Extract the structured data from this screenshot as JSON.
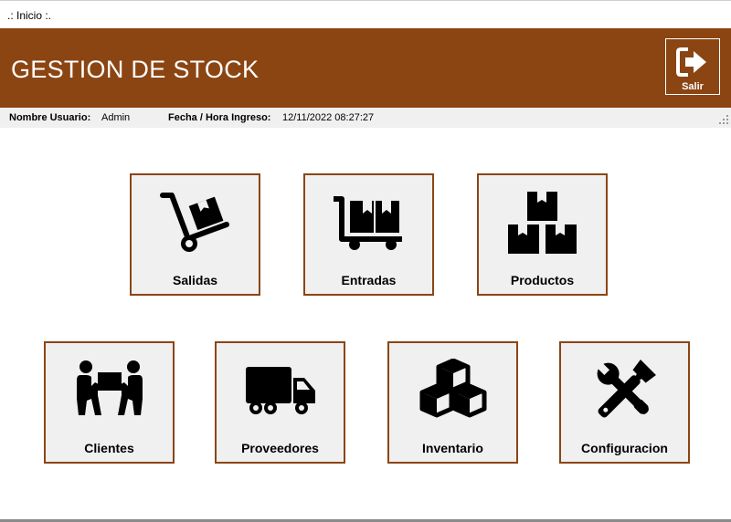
{
  "window": {
    "title": ".: Inicio :."
  },
  "header": {
    "title": "GESTION DE STOCK",
    "exit_label": "Salir",
    "bg_color": "#8b4513"
  },
  "info": {
    "user_label": "Nombre Usuario:",
    "user_value": "Admin",
    "date_label": "Fecha / Hora Ingreso:",
    "date_value": "12/11/2022 08:27:27"
  },
  "tiles": [
    {
      "label": "Salidas",
      "icon": "hand-truck-icon"
    },
    {
      "label": "Entradas",
      "icon": "cart-box-icon"
    },
    {
      "label": "Productos",
      "icon": "boxes-stack-icon"
    },
    {
      "label": "Clientes",
      "icon": "people-carry-icon"
    },
    {
      "label": "Proveedores",
      "icon": "truck-icon"
    },
    {
      "label": "Inventario",
      "icon": "cubes-icon"
    },
    {
      "label": "Configuracion",
      "icon": "tools-icon"
    }
  ]
}
